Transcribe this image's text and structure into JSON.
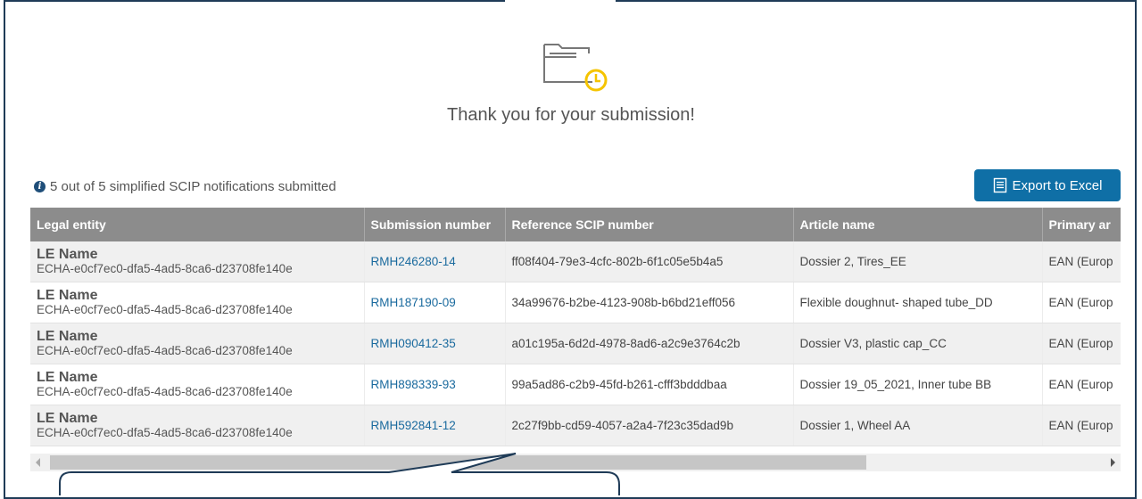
{
  "colors": {
    "frame": "#1f3b57",
    "header_bg": "#8c8c8c",
    "button_bg": "#0f6fa6",
    "link": "#1a6a9e",
    "icon_accent": "#f5c400"
  },
  "icons": {
    "folder": "folder-clock-icon",
    "info": "info-icon",
    "export": "document-icon"
  },
  "confirmation": {
    "message": "Thank you for your submission!"
  },
  "summary": {
    "text": "5 out of 5 simplified SCIP notifications submitted"
  },
  "toolbar": {
    "export_label": "Export to Excel"
  },
  "table": {
    "columns": [
      "Legal entity",
      "Submission number",
      "Reference SCIP number",
      "Article name",
      "Primary ar"
    ],
    "rows": [
      {
        "le_name": "LE Name",
        "le_id": "ECHA-e0cf7ec0-dfa5-4ad5-8ca6-d23708fe140e",
        "submission": "RMH246280-14",
        "reference": "ff08f404-79e3-4cfc-802b-6f1c05e5b4a5",
        "article": "Dossier 2, Tires_EE",
        "primary": "EAN (Europ"
      },
      {
        "le_name": "LE Name",
        "le_id": "ECHA-e0cf7ec0-dfa5-4ad5-8ca6-d23708fe140e",
        "submission": "RMH187190-09",
        "reference": "34a99676-b2be-4123-908b-b6bd21eff056",
        "article": "Flexible doughnut- shaped tube_DD",
        "primary": "EAN (Europ"
      },
      {
        "le_name": "LE Name",
        "le_id": "ECHA-e0cf7ec0-dfa5-4ad5-8ca6-d23708fe140e",
        "submission": "RMH090412-35",
        "reference": "a01c195a-6d2d-4978-8ad6-a2c9e3764c2b",
        "article": "Dossier V3, plastic cap_CC",
        "primary": "EAN (Europ"
      },
      {
        "le_name": "LE Name",
        "le_id": "ECHA-e0cf7ec0-dfa5-4ad5-8ca6-d23708fe140e",
        "submission": "RMH898339-93",
        "reference": "99a5ad86-c2b9-45fd-b261-cfff3bdddbaa",
        "article": "Dossier 19_05_2021, Inner tube BB",
        "primary": "EAN (Europ"
      },
      {
        "le_name": "LE Name",
        "le_id": "ECHA-e0cf7ec0-dfa5-4ad5-8ca6-d23708fe140e",
        "submission": "RMH592841-12",
        "reference": "2c27f9bb-cd59-4057-a2a4-7f23c35dad9b",
        "article": "Dossier 1, Wheel AA",
        "primary": "EAN (Europ"
      }
    ]
  },
  "scrollbar": {
    "horizontal_position": 0
  }
}
